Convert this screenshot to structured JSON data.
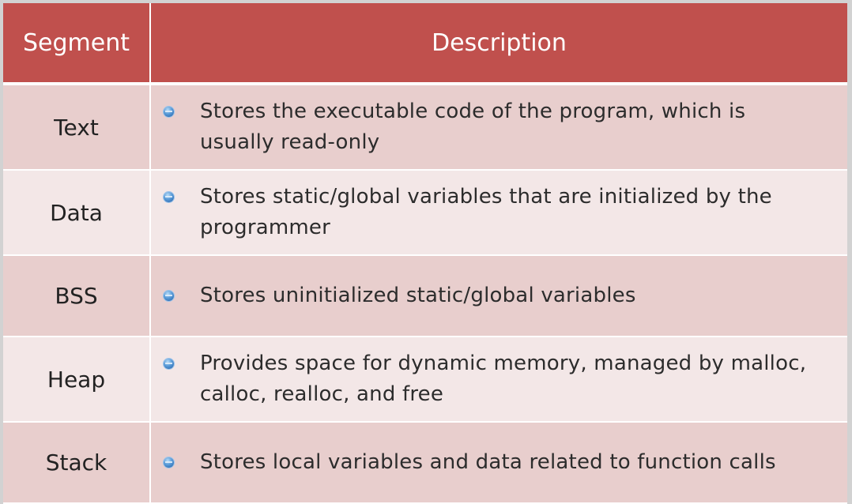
{
  "header": {
    "segment_label": "Segment",
    "description_label": "Description"
  },
  "rows": [
    {
      "segment": "Text",
      "description": "Stores the executable code of the program, which is usually read-only"
    },
    {
      "segment": "Data",
      "description": "Stores static/global variables that are initialized by the programmer"
    },
    {
      "segment": "BSS",
      "description": "Stores uninitialized static/global variables"
    },
    {
      "segment": "Heap",
      "description": "Provides space for dynamic memory, managed by malloc, calloc, realloc, and free"
    },
    {
      "segment": "Stack",
      "description": "Stores local variables and data related to function calls"
    }
  ],
  "colors": {
    "header_bg": "#c0504d",
    "row_odd_bg": "#e8cecd",
    "row_even_bg": "#f3e7e7",
    "bullet": "#5a9bd8"
  },
  "icons": {
    "bullet": "round-bullet-icon"
  }
}
